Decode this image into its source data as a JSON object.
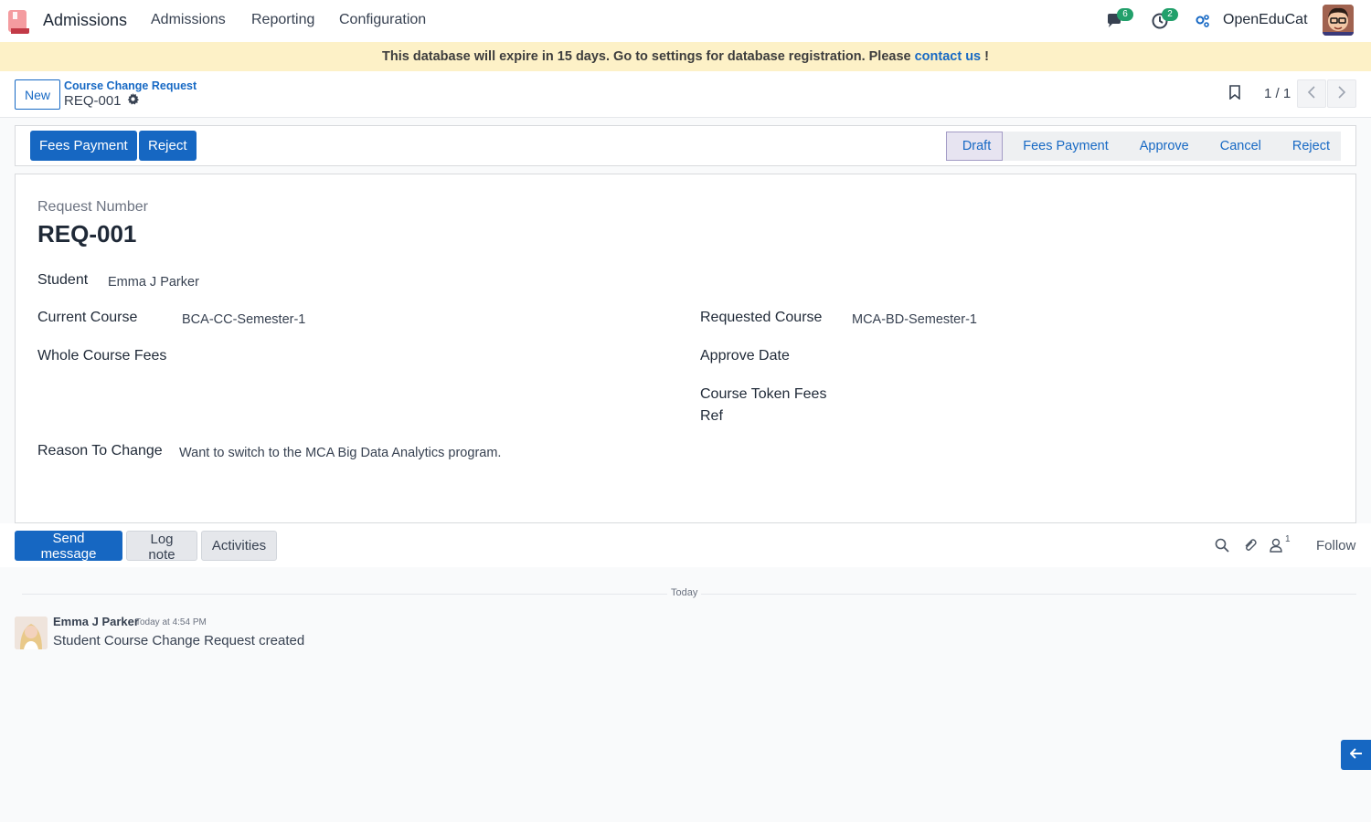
{
  "navbar": {
    "app_name": "Admissions",
    "menus": [
      "Admissions",
      "Reporting",
      "Configuration"
    ],
    "messages_badge": "6",
    "activities_badge": "2",
    "company": "OpenEduCat"
  },
  "banner": {
    "text": "This database will expire in 15 days. Go to settings for database registration. Please ",
    "link": "contact us",
    "suffix": " !"
  },
  "control_panel": {
    "new_label": "New",
    "breadcrumb_parent": "Course Change Request",
    "breadcrumb_current": "REQ-001",
    "pager": "1 / 1"
  },
  "statusbar": {
    "buttons": [
      "Fees Payment",
      "Reject"
    ],
    "stages": [
      "Draft",
      "Fees Payment",
      "Approve",
      "Cancel",
      "Reject"
    ],
    "active_stage": "Draft"
  },
  "form": {
    "request_number_label": "Request Number",
    "request_number": "REQ-001",
    "student_label": "Student",
    "student": "Emma J Parker",
    "current_course_label": "Current Course",
    "current_course": "BCA-CC-Semester-1",
    "requested_course_label": "Requested Course",
    "requested_course": "MCA-BD-Semester-1",
    "whole_course_fees_label": "Whole Course Fees",
    "approve_date_label": "Approve Date",
    "course_token_fees_label": "Course Token Fees",
    "ref_label": "Ref",
    "reason_label": "Reason To Change",
    "reason": "Want to switch to the MCA Big Data Analytics program."
  },
  "chatter": {
    "send_message": "Send message",
    "log_note": "Log note",
    "activities": "Activities",
    "followers_count": "1",
    "follow": "Follow",
    "date_separator": "Today",
    "message": {
      "author": "Emma J Parker",
      "time": "Today at 4:54 PM",
      "body": "Student Course Change Request created"
    }
  },
  "colors": {
    "primary": "#1667c2",
    "link": "#1769c4",
    "banner_bg": "#fdf1c7",
    "badge": "#22a06b"
  }
}
